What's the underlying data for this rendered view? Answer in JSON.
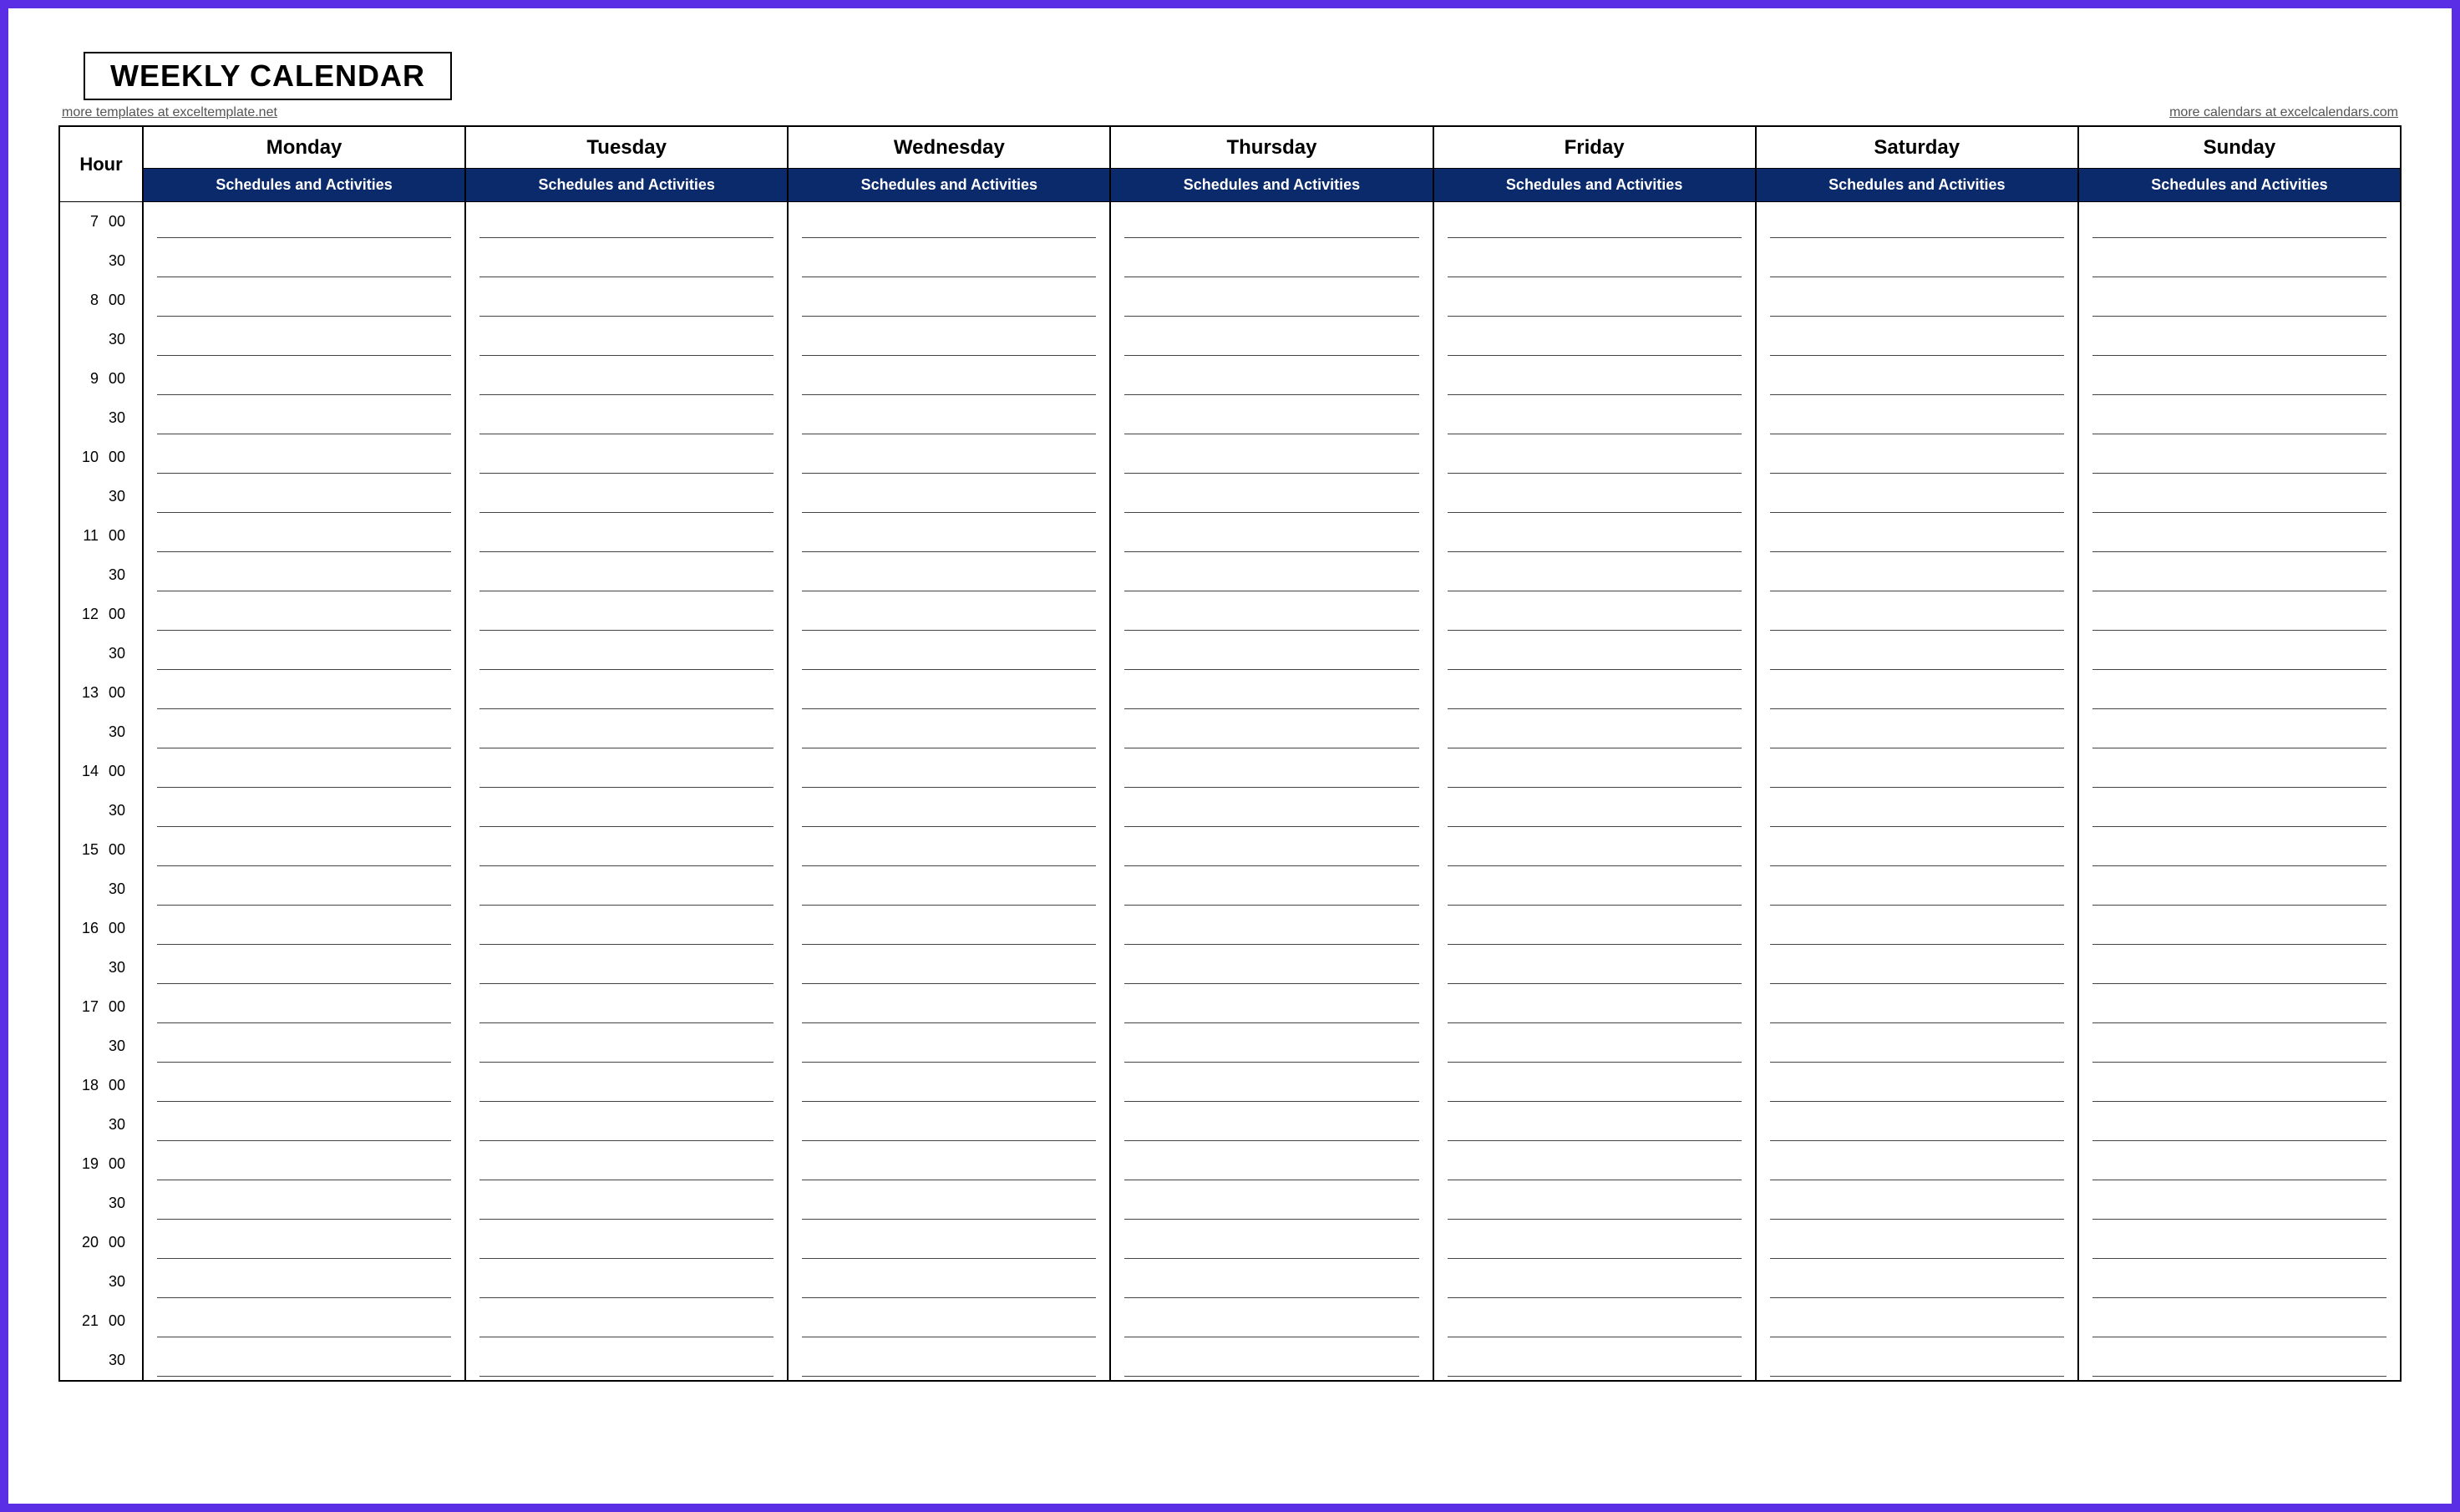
{
  "title": "WEEKLY CALENDAR",
  "link_left": "more templates at exceltemplate.net",
  "link_right": "more calendars at excelcalendars.com",
  "hour_label": "Hour",
  "subheader": "Schedules and Activities",
  "days": [
    "Monday",
    "Tuesday",
    "Wednesday",
    "Thursday",
    "Friday",
    "Saturday",
    "Sunday"
  ],
  "hours": [
    7,
    8,
    9,
    10,
    11,
    12,
    13,
    14,
    15,
    16,
    17,
    18,
    19,
    20,
    21
  ],
  "minutes": [
    "00",
    "30"
  ]
}
